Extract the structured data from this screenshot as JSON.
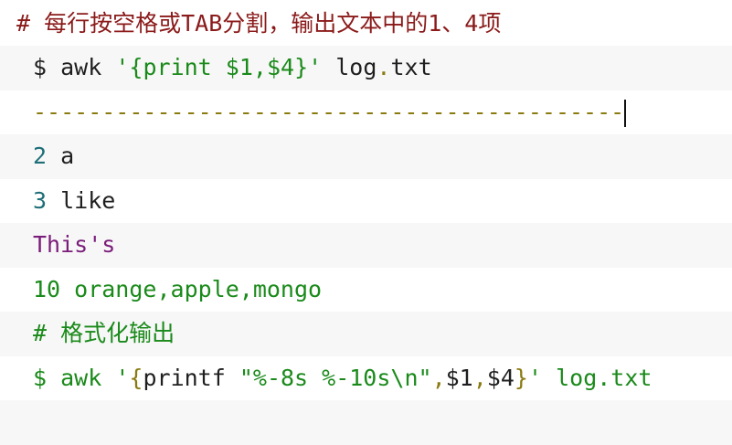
{
  "lines": [
    {
      "text": "# 每行按空格或TAB分割，输出文本中的1、4项"
    },
    {
      "dollar": "$",
      "cmd": "awk",
      "q1": "'",
      "b1": "{",
      "print": "print",
      "v1": "$1,$4",
      "b2": "}",
      "q2": "'",
      "file_a": "log",
      "dot": ".",
      "file_b": "txt"
    },
    {
      "text": "-------------------------------------------"
    },
    {
      "num": "2",
      "word": "a"
    },
    {
      "num": "3",
      "word": "like"
    },
    {
      "text": "This's"
    },
    {
      "text": "10 orange,apple,mongo"
    },
    {
      "text": "# 格式化输出"
    },
    {
      "dollar": "$",
      "cmd": "awk",
      "q1": "'",
      "b1": "{",
      "printf": "printf",
      "fmt": "\"%-8s %-10s\\n\"",
      "c1": ",",
      "v1": "$1",
      "c2": ",",
      "v2": "$4",
      "b2": "}",
      "q2": "'",
      "file": "log.txt"
    }
  ],
  "colors": {
    "comment_red": "#8b1a1a",
    "green": "#1a8a1a",
    "olive": "#8a7a10",
    "teal": "#1f6f78",
    "purple": "#7a1d7a",
    "alt_bg": "#f7f7f7"
  }
}
